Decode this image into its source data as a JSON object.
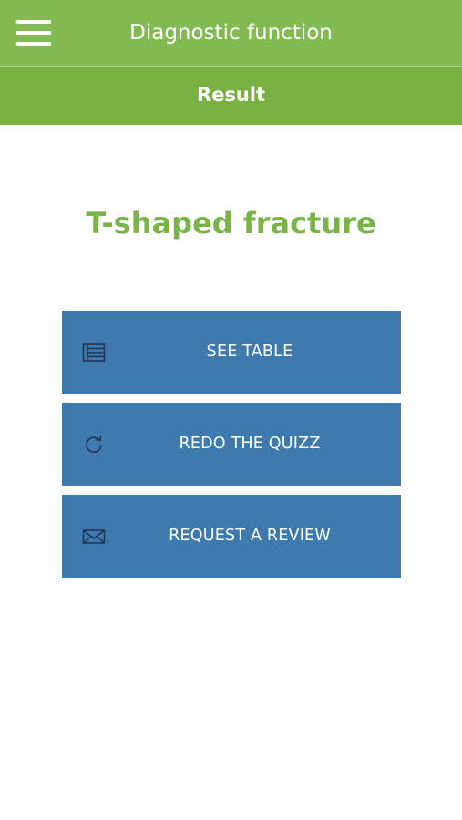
{
  "header": {
    "title": "Diagnostic function",
    "menu_icon": "hamburger-menu-icon"
  },
  "subheader": {
    "title": "Result"
  },
  "result": {
    "title": "T-shaped fracture"
  },
  "actions": [
    {
      "label": "SEE TABLE",
      "icon": "table-icon"
    },
    {
      "label": "REDO THE QUIZZ",
      "icon": "refresh-icon"
    },
    {
      "label": "REQUEST A REVIEW",
      "icon": "envelope-icon"
    }
  ],
  "colors": {
    "header_bg": "#82bb52",
    "subheader_bg": "#78b142",
    "accent_green": "#79b446",
    "button_bg": "#3f7aae",
    "icon_color": "#1f3550"
  }
}
